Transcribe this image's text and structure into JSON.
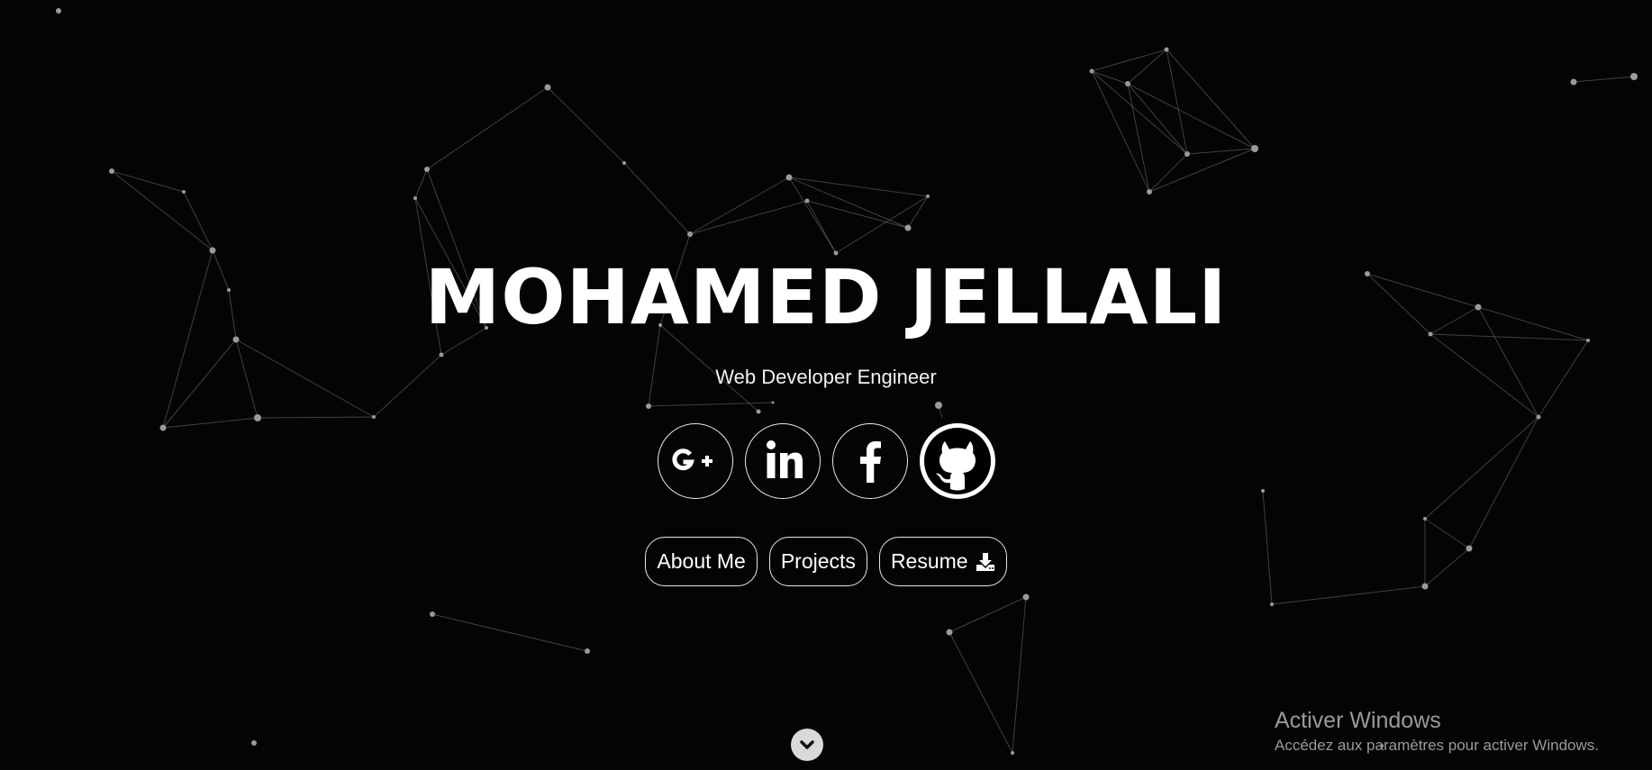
{
  "hero": {
    "name": "MOHAMED JELLALI",
    "subtitle": "Web Developer Engineer"
  },
  "socials": [
    {
      "icon": "google-plus-icon",
      "label": "G+"
    },
    {
      "icon": "linkedin-icon",
      "label": "in"
    },
    {
      "icon": "facebook-icon",
      "label": "f"
    },
    {
      "icon": "github-icon",
      "label": ""
    }
  ],
  "buttons": {
    "about": "About Me",
    "projects": "Projects",
    "resume": "Resume",
    "resume_icon": "download-icon"
  },
  "scroll": {
    "icon": "chevron-down-icon"
  },
  "watermark": {
    "title": "Activer Windows",
    "subtitle": "Accédez aux paramètres pour activer Windows."
  },
  "colors": {
    "background": "#040404",
    "text": "#ffffff",
    "particles": "#9a9a9a",
    "watermark": "#9a9a9a"
  }
}
